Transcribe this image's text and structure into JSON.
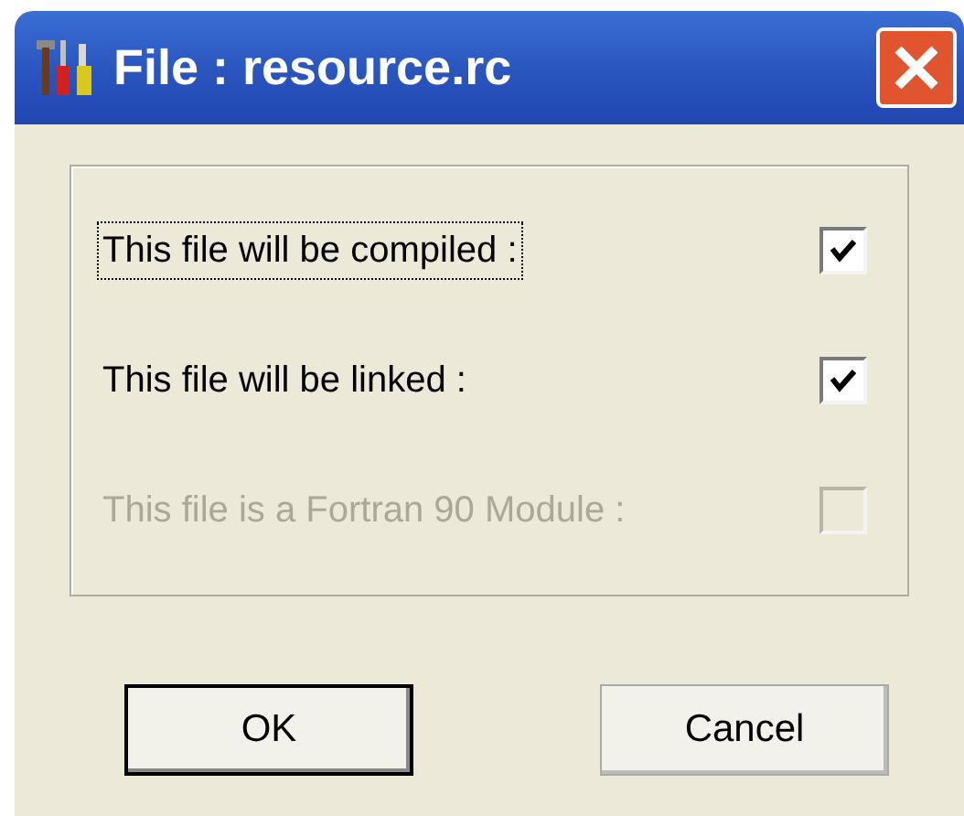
{
  "window": {
    "title": "File : resource.rc"
  },
  "options": [
    {
      "label": "This file will be compiled :",
      "checked": true,
      "disabled": false,
      "focused": true
    },
    {
      "label": "This file will be linked :",
      "checked": true,
      "disabled": false,
      "focused": false
    },
    {
      "label": "This file is a Fortran 90 Module :",
      "checked": false,
      "disabled": true,
      "focused": false
    }
  ],
  "buttons": [
    {
      "label": "OK",
      "default": true
    },
    {
      "label": "Cancel",
      "default": false
    }
  ]
}
